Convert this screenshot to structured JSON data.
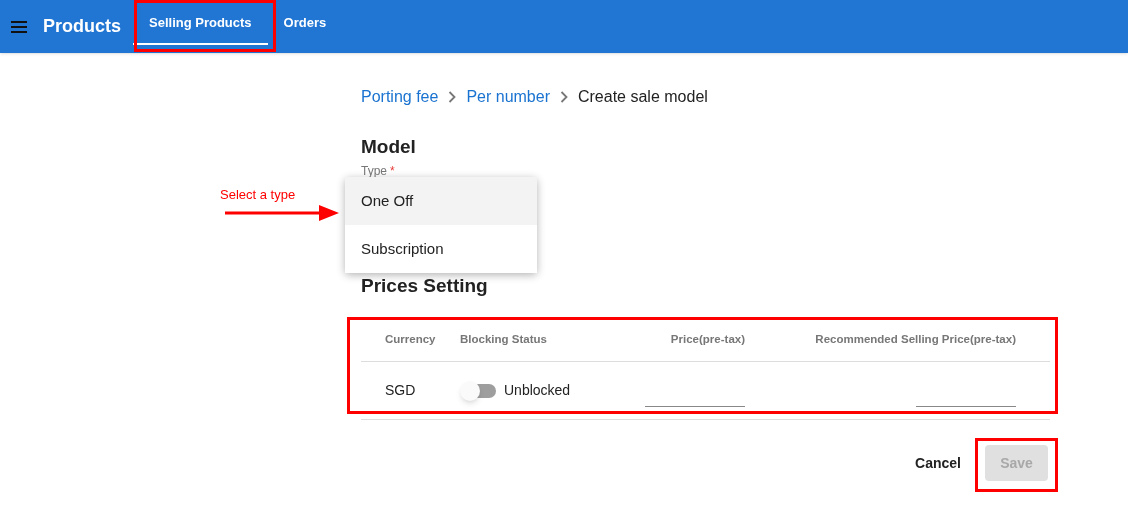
{
  "app_bar": {
    "title": "Products",
    "tabs": [
      {
        "label": "Selling Products",
        "selected": true
      },
      {
        "label": "Orders",
        "selected": false
      }
    ]
  },
  "breadcrumb": [
    {
      "label": "Porting fee",
      "link": true
    },
    {
      "label": "Per number",
      "link": true
    },
    {
      "label": "Create sale model",
      "link": false
    }
  ],
  "model": {
    "heading": "Model",
    "type_field": {
      "label": "Type",
      "required_mark": "*"
    },
    "menu": [
      {
        "label": "One Off",
        "highlighted": true
      },
      {
        "label": "Subscription",
        "highlighted": false
      }
    ]
  },
  "prices": {
    "heading": "Prices Setting",
    "columns": [
      "Currency",
      "Blocking Status",
      "Price(pre-tax)",
      "Recommended Selling Price(pre-tax)"
    ],
    "rows": [
      {
        "currency": "SGD",
        "blocked": false,
        "status": "Unblocked"
      }
    ]
  },
  "actions": {
    "cancel": "Cancel",
    "save": {
      "label": "Save",
      "disabled": true
    }
  },
  "annotation": {
    "text": "Select a type"
  }
}
